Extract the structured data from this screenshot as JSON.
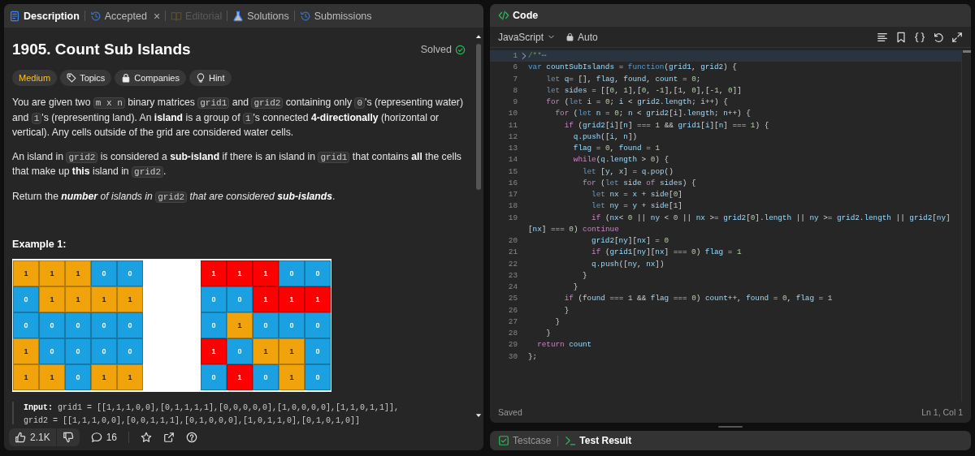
{
  "tabs": [
    {
      "label": "Description",
      "selected": true,
      "disabled": false
    },
    {
      "label": "Accepted",
      "selected": false,
      "disabled": false,
      "close": "×"
    },
    {
      "label": "Editorial",
      "selected": false,
      "disabled": true
    },
    {
      "label": "Solutions",
      "selected": false,
      "disabled": false
    },
    {
      "label": "Submissions",
      "selected": false,
      "disabled": false
    }
  ],
  "problem": {
    "title": "1905. Count Sub Islands",
    "status": "Solved",
    "tags": [
      {
        "label": "Medium",
        "kind": "difficulty"
      },
      {
        "label": "Topics",
        "kind": "chip"
      },
      {
        "label": "Companies",
        "kind": "chip"
      },
      {
        "label": "Hint",
        "kind": "chip"
      }
    ],
    "paragraphs": [
      [
        {
          "kind": "text",
          "text": "You are given two "
        },
        {
          "kind": "code",
          "text": "m x n"
        },
        {
          "kind": "text",
          "text": " binary matrices "
        },
        {
          "kind": "code",
          "text": "grid1"
        },
        {
          "kind": "text",
          "text": " and "
        },
        {
          "kind": "code",
          "text": "grid2"
        },
        {
          "kind": "text",
          "text": " containing only "
        },
        {
          "kind": "code",
          "text": "0"
        },
        {
          "kind": "text",
          "text": "'s (representing water) and "
        },
        {
          "kind": "code",
          "text": "1"
        },
        {
          "kind": "text",
          "text": "'s (representing land). An **island** is a group of "
        },
        {
          "kind": "code",
          "text": "1"
        },
        {
          "kind": "text",
          "text": "'s connected **4-directionally** (horizontal or vertical). Any cells outside of the grid are considered water cells."
        }
      ],
      [
        {
          "kind": "text",
          "text": "An island in "
        },
        {
          "kind": "code",
          "text": "grid2"
        },
        {
          "kind": "text",
          "text": " is considered a **sub-island** if there is an island in "
        },
        {
          "kind": "code",
          "text": "grid1"
        },
        {
          "kind": "text",
          "text": " that contains **all** the cells that make up **this** island in "
        },
        {
          "kind": "code",
          "text": "grid2"
        },
        {
          "kind": "text",
          "text": "."
        }
      ],
      [
        {
          "kind": "text",
          "text": "Return the "
        },
        {
          "kind": "italic",
          "text": "**number** of islands in "
        },
        {
          "kind": "code",
          "text": "grid2"
        },
        {
          "kind": "italic",
          "text": " that are considered **sub-islands**"
        },
        {
          "kind": "text",
          "text": "."
        }
      ]
    ],
    "example_heading": "Example 1:",
    "grids": [
      [
        [
          {
            "text": "1",
            "color": "#f0a30a"
          },
          {
            "text": "1",
            "color": "#f0a30a"
          },
          {
            "text": "1",
            "color": "#f0a30a"
          },
          {
            "text": "0",
            "color": "#1ba1e2"
          },
          {
            "text": "0",
            "color": "#1ba1e2"
          }
        ],
        [
          {
            "text": "0",
            "color": "#1ba1e2"
          },
          {
            "text": "1",
            "color": "#f0a30a"
          },
          {
            "text": "1",
            "color": "#f0a30a"
          },
          {
            "text": "1",
            "color": "#f0a30a"
          },
          {
            "text": "1",
            "color": "#f0a30a"
          }
        ],
        [
          {
            "text": "0",
            "color": "#1ba1e2"
          },
          {
            "text": "0",
            "color": "#1ba1e2"
          },
          {
            "text": "0",
            "color": "#1ba1e2"
          },
          {
            "text": "0",
            "color": "#1ba1e2"
          },
          {
            "text": "0",
            "color": "#1ba1e2"
          }
        ],
        [
          {
            "text": "1",
            "color": "#f0a30a"
          },
          {
            "text": "0",
            "color": "#1ba1e2"
          },
          {
            "text": "0",
            "color": "#1ba1e2"
          },
          {
            "text": "0",
            "color": "#1ba1e2"
          },
          {
            "text": "0",
            "color": "#1ba1e2"
          }
        ],
        [
          {
            "text": "1",
            "color": "#f0a30a"
          },
          {
            "text": "1",
            "color": "#f0a30a"
          },
          {
            "text": "0",
            "color": "#1ba1e2"
          },
          {
            "text": "1",
            "color": "#f0a30a"
          },
          {
            "text": "1",
            "color": "#f0a30a"
          }
        ]
      ],
      [
        [
          {
            "text": "1",
            "color": "#ff0000"
          },
          {
            "text": "1",
            "color": "#ff0000"
          },
          {
            "text": "1",
            "color": "#ff0000"
          },
          {
            "text": "0",
            "color": "#1ba1e2"
          },
          {
            "text": "0",
            "color": "#1ba1e2"
          }
        ],
        [
          {
            "text": "0",
            "color": "#1ba1e2"
          },
          {
            "text": "0",
            "color": "#1ba1e2"
          },
          {
            "text": "1",
            "color": "#ff0000"
          },
          {
            "text": "1",
            "color": "#ff0000"
          },
          {
            "text": "1",
            "color": "#ff0000"
          }
        ],
        [
          {
            "text": "0",
            "color": "#1ba1e2"
          },
          {
            "text": "1",
            "color": "#f0a30a"
          },
          {
            "text": "0",
            "color": "#1ba1e2"
          },
          {
            "text": "0",
            "color": "#1ba1e2"
          },
          {
            "text": "0",
            "color": "#1ba1e2"
          }
        ],
        [
          {
            "text": "1",
            "color": "#ff0000"
          },
          {
            "text": "0",
            "color": "#1ba1e2"
          },
          {
            "text": "1",
            "color": "#f0a30a"
          },
          {
            "text": "1",
            "color": "#f0a30a"
          },
          {
            "text": "0",
            "color": "#1ba1e2"
          }
        ],
        [
          {
            "text": "0",
            "color": "#1ba1e2"
          },
          {
            "text": "1",
            "color": "#ff0000"
          },
          {
            "text": "0",
            "color": "#1ba1e2"
          },
          {
            "text": "1",
            "color": "#f0a30a"
          },
          {
            "text": "0",
            "color": "#1ba1e2"
          }
        ]
      ]
    ],
    "input": {
      "label": "Input:",
      "lines": [
        "grid1 = [[1,1,1,0,0],[0,1,1,1,1],[0,0,0,0,0],[1,0,0,0,0],[1,1,0,1,1]],",
        "grid2 = [[1,1,1,0,0],[0,0,1,1,1],[0,1,0,0,0],[1,0,1,1,0],[0,1,0,1,0]]"
      ]
    }
  },
  "footer": {
    "likes": "2.1K",
    "comments": "16"
  },
  "editor": {
    "title": "Code",
    "language": "JavaScript",
    "mode": "Auto",
    "lines": [
      {
        "kind": "folded",
        "number": "1",
        "text": "/**",
        "fold": "⋯",
        "selected": true
      },
      {
        "kind": "code",
        "number": "6",
        "text": "var countSubIslands = function(grid1, grid2) {",
        "selected": false
      },
      {
        "kind": "code",
        "number": "7",
        "text": "    let q= [], flag, found, count = 0;",
        "selected": false
      },
      {
        "kind": "code",
        "number": "8",
        "text": "    let sides = [[0, 1],[0, -1],[1, 0],[-1, 0]]",
        "selected": false
      },
      {
        "kind": "code",
        "number": "9",
        "text": "    for (let i = 0; i < grid2.length; i++) {",
        "selected": false
      },
      {
        "kind": "code",
        "number": "10",
        "text": "      for (let n = 0; n < grid2[i].length; n++) {",
        "selected": false
      },
      {
        "kind": "code",
        "number": "11",
        "text": "        if (grid2[i][n] === 1 && grid1[i][n] === 1) {",
        "selected": false
      },
      {
        "kind": "code",
        "number": "12",
        "text": "          q.push([i, n])",
        "selected": false
      },
      {
        "kind": "code",
        "number": "13",
        "text": "          flag = 0, found = 1",
        "selected": false
      },
      {
        "kind": "code",
        "number": "14",
        "text": "          while(q.length > 0) {",
        "selected": false
      },
      {
        "kind": "code",
        "number": "15",
        "text": "            let [y, x] = q.pop()",
        "selected": false
      },
      {
        "kind": "code",
        "number": "16",
        "text": "            for (let side of sides) {",
        "selected": false
      },
      {
        "kind": "code",
        "number": "17",
        "text": "              let nx = x + side[0]",
        "selected": false
      },
      {
        "kind": "code",
        "number": "18",
        "text": "              let ny = y + side[1]",
        "selected": false
      },
      {
        "kind": "code",
        "number": "19",
        "text": "              if (nx< 0 || ny < 0 || nx >= grid2[0].length || ny >= grid2.length || grid2[ny]",
        "selected": false
      },
      {
        "kind": "wrap",
        "text": "[nx] === 0) continue",
        "selected": false
      },
      {
        "kind": "code",
        "number": "20",
        "text": "              grid2[ny][nx] = 0",
        "selected": false
      },
      {
        "kind": "code",
        "number": "21",
        "text": "              if (grid1[ny][nx] === 0) flag = 1",
        "selected": false
      },
      {
        "kind": "code",
        "number": "22",
        "text": "              q.push([ny, nx])",
        "selected": false
      },
      {
        "kind": "code",
        "number": "23",
        "text": "            }",
        "selected": false
      },
      {
        "kind": "code",
        "number": "24",
        "text": "          }",
        "selected": false
      },
      {
        "kind": "code",
        "number": "25",
        "text": "        if (found === 1 && flag === 0) count++, found = 0, flag = 1",
        "selected": false
      },
      {
        "kind": "code",
        "number": "26",
        "text": "        }",
        "selected": false
      },
      {
        "kind": "code",
        "number": "27",
        "text": "      }",
        "selected": false
      },
      {
        "kind": "code",
        "number": "28",
        "text": "    }",
        "selected": false
      },
      {
        "kind": "code",
        "number": "29",
        "text": "  return count",
        "selected": false
      },
      {
        "kind": "code",
        "number": "30",
        "text": "};",
        "selected": false
      }
    ],
    "status": "Saved",
    "cursor": "Ln 1, Col 1"
  },
  "console_tabs": [
    {
      "label": "Testcase",
      "selected": false
    },
    {
      "label": "Test Result",
      "selected": true
    }
  ]
}
